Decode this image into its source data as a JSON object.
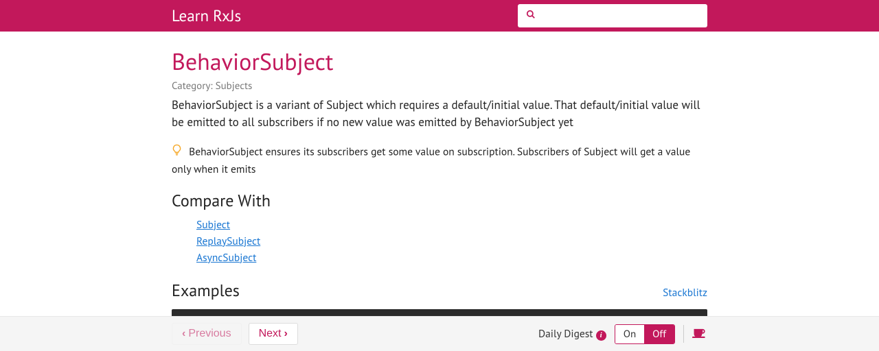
{
  "site": {
    "title": "Learn RxJs"
  },
  "search": {
    "placeholder": ""
  },
  "page": {
    "title": "BehaviorSubject",
    "category": "Category: Subjects",
    "description": "BehaviorSubject is a variant of Subject which requires a default/initial value. That default/initial value will be emitted to all subscribers if no new value was emitted by BehaviorSubject yet",
    "tip": "BehaviorSubject ensures its subscribers get some value on subscription. Subscribers of Subject will get a value only when it emits"
  },
  "compare": {
    "heading": "Compare With",
    "items": [
      "Subject",
      "ReplaySubject",
      "AsyncSubject"
    ]
  },
  "examples": {
    "heading": "Examples",
    "link": "Stackblitz"
  },
  "footer": {
    "prev": "Previous",
    "next": "Next",
    "digest_label": "Daily Digest",
    "toggle_on": "On",
    "toggle_off": "Off"
  }
}
